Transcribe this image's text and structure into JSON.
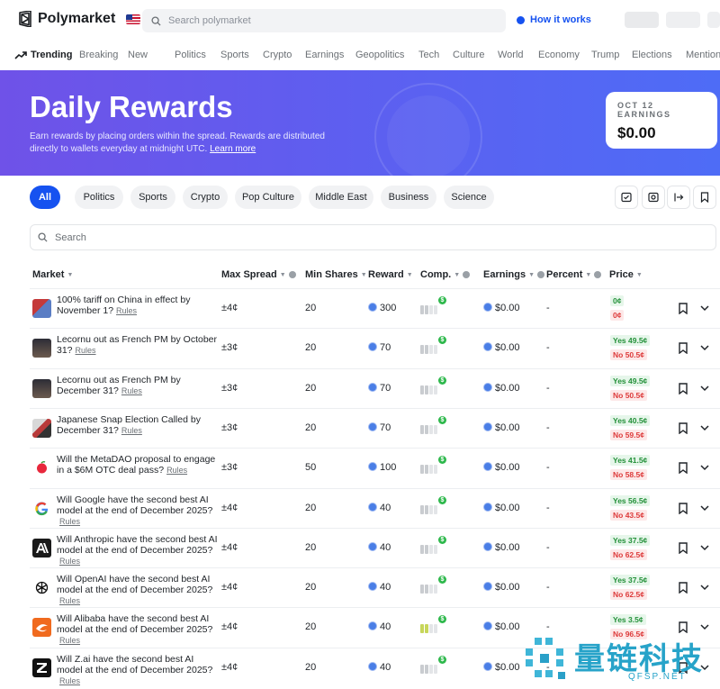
{
  "header": {
    "brand": "Polymarket",
    "search_placeholder": "Search polymarket",
    "how_it_works": "How it works"
  },
  "categories": [
    "Trending",
    "Breaking",
    "New",
    "Politics",
    "Sports",
    "Crypto",
    "Earnings",
    "Geopolitics",
    "Tech",
    "Culture",
    "World",
    "Economy",
    "Trump",
    "Elections",
    "Mention"
  ],
  "hero": {
    "title": "Daily Rewards",
    "desc": "Earn rewards by placing orders within the spread. Rewards are distributed directly to wallets everyday at midnight UTC.",
    "learn_more": "Learn more",
    "earnings_label": "OCT 12 EARNINGS",
    "earnings_value": "$0.00"
  },
  "filters": [
    "All",
    "Politics",
    "Sports",
    "Crypto",
    "Pop Culture",
    "Middle East",
    "Business",
    "Science"
  ],
  "list_search_placeholder": "Search",
  "columns": [
    "Market",
    "Max Spread",
    "Min Shares",
    "Reward",
    "Comp.",
    "Earnings",
    "Percent",
    "Price"
  ],
  "rows": [
    {
      "title": "100% tariff on China in effect by November 1?",
      "spread": "±4¢",
      "min": "20",
      "reward": "300",
      "earn": "$0.00",
      "pct": "-",
      "yes": "0¢",
      "no": "0¢"
    },
    {
      "title": "Lecornu out as French PM by October 31?",
      "spread": "±3¢",
      "min": "20",
      "reward": "70",
      "earn": "$0.00",
      "pct": "-",
      "yes": "Yes 49.5¢",
      "no": "No 50.5¢"
    },
    {
      "title": "Lecornu out as French PM by December 31?",
      "spread": "±3¢",
      "min": "20",
      "reward": "70",
      "earn": "$0.00",
      "pct": "-",
      "yes": "Yes 49.5¢",
      "no": "No 50.5¢"
    },
    {
      "title": "Japanese Snap Election Called by December 31?",
      "spread": "±3¢",
      "min": "20",
      "reward": "70",
      "earn": "$0.00",
      "pct": "-",
      "yes": "Yes 40.5¢",
      "no": "No 59.5¢"
    },
    {
      "title": "Will the MetaDAO proposal to engage in a $6M OTC deal pass?",
      "spread": "±3¢",
      "min": "50",
      "reward": "100",
      "earn": "$0.00",
      "pct": "-",
      "yes": "Yes 41.5¢",
      "no": "No 58.5¢"
    },
    {
      "title": "Will Google have the second best AI model at the end of December 2025?",
      "spread": "±4¢",
      "min": "20",
      "reward": "40",
      "earn": "$0.00",
      "pct": "-",
      "yes": "Yes 56.5¢",
      "no": "No 43.5¢"
    },
    {
      "title": "Will Anthropic have the second best AI model at the end of December 2025?",
      "spread": "±4¢",
      "min": "20",
      "reward": "40",
      "earn": "$0.00",
      "pct": "-",
      "yes": "Yes 37.5¢",
      "no": "No 62.5¢"
    },
    {
      "title": "Will OpenAI have the second best AI model at the end of December 2025?",
      "spread": "±4¢",
      "min": "20",
      "reward": "40",
      "earn": "$0.00",
      "pct": "-",
      "yes": "Yes 37.5¢",
      "no": "No 62.5¢"
    },
    {
      "title": "Will Alibaba have the second best AI model at the end of December 2025?",
      "spread": "±4¢",
      "min": "20",
      "reward": "40",
      "earn": "$0.00",
      "pct": "-",
      "yes": "Yes 3.5¢",
      "no": "No 96.5¢"
    },
    {
      "title": "Will Z.ai have the second best AI model at the end of December 2025?",
      "spread": "±4¢",
      "min": "20",
      "reward": "40",
      "earn": "$0.00",
      "pct": "-",
      "yes": "",
      "no": ""
    }
  ],
  "rules_label": "Rules",
  "watermark": {
    "text": "量链科技",
    "sub": "QFSP.NET"
  }
}
